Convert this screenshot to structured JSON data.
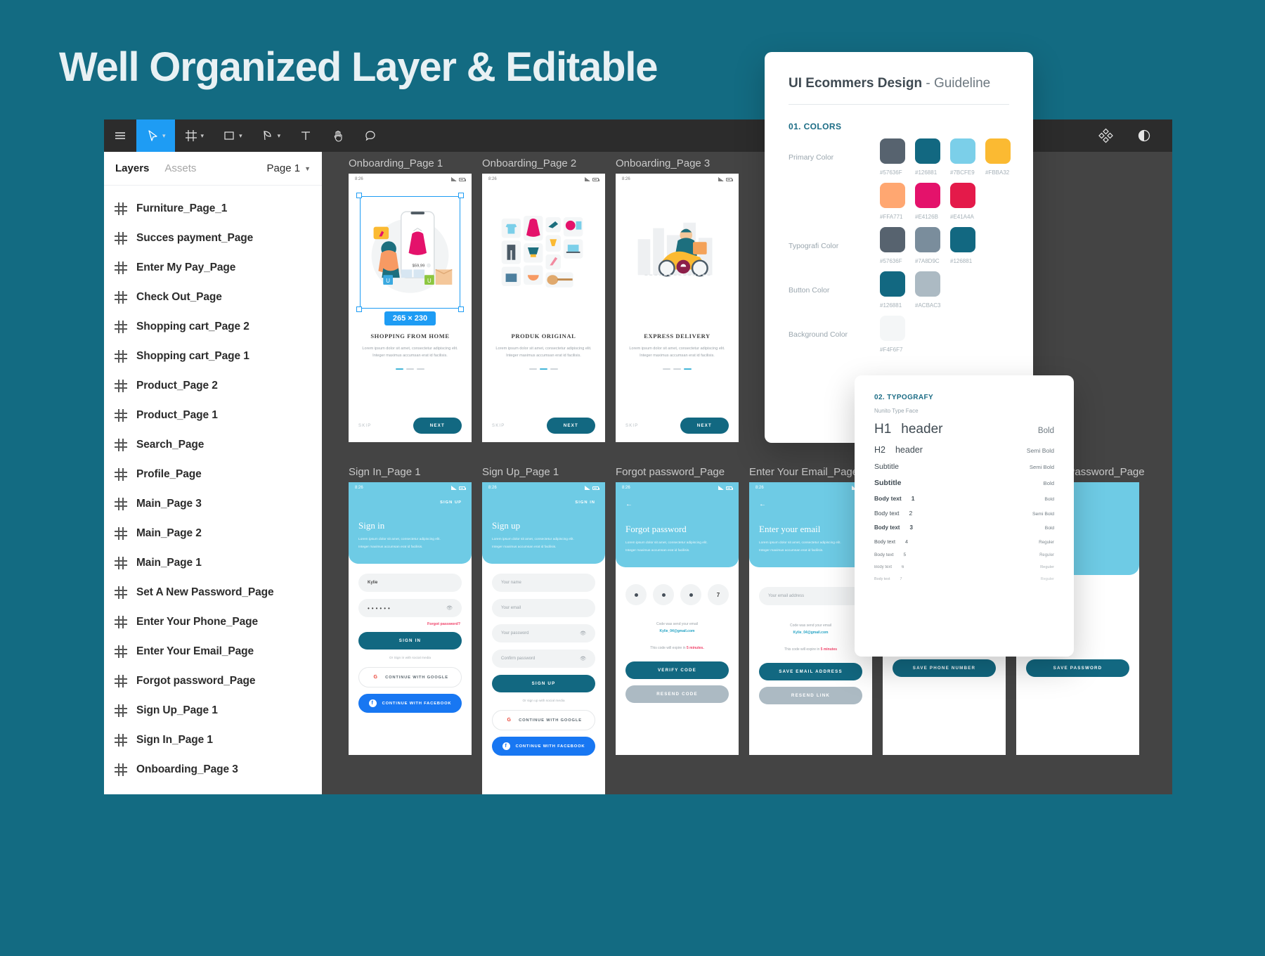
{
  "hero": {
    "title": "Well Organized Layer & Editable"
  },
  "toolbar": {
    "items": [
      {
        "name": "menu-icon",
        "label": "Menu",
        "caret": false
      },
      {
        "name": "move-tool-icon",
        "label": "Move",
        "caret": true
      },
      {
        "name": "frame-tool-icon",
        "label": "Frame",
        "caret": true
      },
      {
        "name": "shape-tool-icon",
        "label": "Shape",
        "caret": true
      },
      {
        "name": "pen-tool-icon",
        "label": "Pen",
        "caret": true
      },
      {
        "name": "text-tool-icon",
        "label": "Text",
        "caret": false
      },
      {
        "name": "hand-tool-icon",
        "label": "Hand",
        "caret": false
      },
      {
        "name": "comment-tool-icon",
        "label": "Comment",
        "caret": false
      }
    ],
    "right": [
      {
        "name": "components-icon",
        "label": "Components"
      },
      {
        "name": "contrast-icon",
        "label": "Contrast"
      }
    ]
  },
  "layers_panel": {
    "tab_layers": "Layers",
    "tab_assets": "Assets",
    "page_selector": "Page 1",
    "items": [
      {
        "label": "Furniture_Page_1"
      },
      {
        "label": "Succes payment_Page"
      },
      {
        "label": "Enter My Pay_Page"
      },
      {
        "label": "Check Out_Page"
      },
      {
        "label": "Shopping cart_Page 2"
      },
      {
        "label": "Shopping cart_Page 1"
      },
      {
        "label": "Product_Page 2"
      },
      {
        "label": "Product_Page 1"
      },
      {
        "label": "Search_Page"
      },
      {
        "label": "Profile_Page"
      },
      {
        "label": "Main_Page 3"
      },
      {
        "label": "Main_Page 2"
      },
      {
        "label": "Main_Page 1"
      },
      {
        "label": "Set A New Password_Page"
      },
      {
        "label": "Enter Your Phone_Page"
      },
      {
        "label": "Enter Your Email_Page"
      },
      {
        "label": "Forgot password_Page"
      },
      {
        "label": "Sign Up_Page 1"
      },
      {
        "label": "Sign In_Page 1"
      },
      {
        "label": "Onboarding_Page 3"
      }
    ]
  },
  "canvas": {
    "selection_size_badge": "265 × 230",
    "status_time": "8:26",
    "onboarding": [
      {
        "frame_title": "Onboarding_Page 1",
        "heading": "SHOPPING FROM HOME",
        "desc": "Lorem ipsum dolor sit amet, consectetur adipiscing elit. Integer maximus accumsan erat id facilisis.",
        "skip": "SKIP",
        "next": "NEXT",
        "price_tag": "$59,99",
        "active_dot": 0
      },
      {
        "frame_title": "Onboarding_Page 2",
        "heading": "PRODUK ORIGINAL",
        "desc": "Lorem ipsum dolor sit amet, consectetur adipiscing elit. Integer maximus accumsan erat id facilisis.",
        "skip": "SKIP",
        "next": "NEXT",
        "active_dot": 1
      },
      {
        "frame_title": "Onboarding_Page 3",
        "heading": "EXPRESS DELIVERY",
        "desc": "Lorem ipsum dolor sit amet, consectetur adipiscing elit. Integer maximus accumsan erat id facilisis.",
        "skip": "SKIP",
        "next": "NEXT",
        "active_dot": 2
      }
    ],
    "signin": {
      "frame_title": "Sign In_Page 1",
      "top_link": "SIGN UP",
      "title": "Sign in",
      "sub_line1": "Lorem ipsum dolor sit amet, consectetur adipiscing elit.",
      "sub_line2": "Integer maximus accumsan erat id facilisis.",
      "username_value": "Kylie",
      "password_value": "••••••",
      "forgot": "Forgot password?",
      "submit": "SIGN IN",
      "or": "Or Sign in with social media",
      "google": "CONTINUE WITH GOOGLE",
      "facebook": "CONTINUE WITH FACEBOOK"
    },
    "signup": {
      "frame_title": "Sign Up_Page 1",
      "top_link": "SIGN IN",
      "title": "Sign up",
      "sub_line1": "Lorem ipsum dolor sit amet, consectetur adipiscing elit.",
      "sub_line2": "Integer maximus accumsan erat id facilisis.",
      "name_placeholder": "Your name",
      "email_placeholder": "Your email",
      "password_placeholder": "Your password",
      "confirm_placeholder": "Confirm password",
      "submit": "SIGN UP",
      "or": "Or sign up with social media",
      "google": "CONTINUE WITH GOOGLE",
      "facebook": "CONTINUE WITH FACEBOOK"
    },
    "forgot": {
      "frame_title": "Forgot password_Page",
      "title": "Forgot password",
      "sub_line1": "Lorem ipsum dolor sit amet, consectetur adipiscing elit.",
      "sub_line2": "Integer maximus accumsan erat id facilisis.",
      "otp_last": "7",
      "code_sent": "Code was send your email",
      "code_email": "Kylie_04@gmail.com",
      "expire_pre": "This code will expire in",
      "expire_time": "5 minutes.",
      "verify": "VERIFY CODE",
      "resend": "RESEND CODE"
    },
    "enter_email": {
      "frame_title": "Enter Your Email_Page",
      "title": "Enter your email",
      "sub_line1": "Lorem ipsum dolor sit amet, consectetur adipiscing elit.",
      "sub_line2": "Integer maximus accumsan erat id facilisis.",
      "email_placeholder": "Your email address",
      "code_sent": "Code was send your email",
      "code_email": "Kylie_04@gmail.com",
      "expire_pre": "This code will expire in",
      "expire_time": "5 minutes",
      "save": "SAVE EMAIL ADDRESS",
      "resend": "RESEND LINK"
    },
    "enter_phone": {
      "save": "SAVE PHONE NUMBER"
    },
    "set_password": {
      "frame_title": "Set A New Password_Page",
      "save": "SAVE PASSWORD"
    }
  },
  "guideline": {
    "title_bold": "UI Ecommers Design",
    "title_light": " - Guideline",
    "colors_section": "01. COLORS",
    "rows": [
      {
        "label": "Primary Color",
        "swatches": [
          {
            "hex": "#57636F"
          },
          {
            "hex": "#126881"
          },
          {
            "hex": "#7BCFE9"
          },
          {
            "hex": "#FBBA32"
          }
        ]
      },
      {
        "label": "",
        "swatches": [
          {
            "hex": "#FFA771"
          },
          {
            "hex": "#E4126B"
          },
          {
            "hex": "#E41A4A"
          }
        ]
      },
      {
        "label": "Typografi Color",
        "swatches": [
          {
            "hex": "#57636F"
          },
          {
            "hex": "#7A8D9C"
          },
          {
            "hex": "#126881"
          }
        ]
      },
      {
        "label": "Button Color",
        "swatches": [
          {
            "hex": "#126881"
          },
          {
            "hex": "#ACBAC3"
          }
        ]
      },
      {
        "label": "Background Color",
        "swatches": [
          {
            "hex": "#F4F6F7"
          }
        ]
      }
    ]
  },
  "typography": {
    "section": "02. TYPOGRAFY",
    "face": "Nunito Type Face",
    "rows": [
      {
        "name": "H1",
        "sample": "header",
        "weight": "Bold"
      },
      {
        "name": "H2",
        "sample": "header",
        "weight": "Semi Bold"
      },
      {
        "name": "Subtitle",
        "sample": "",
        "weight": "Semi Bold"
      },
      {
        "name": "Subtitle",
        "sample": "",
        "weight": "Bold"
      },
      {
        "name": "Body text",
        "sample": "1",
        "weight": "Bold"
      },
      {
        "name": "Body text",
        "sample": "2",
        "weight": "Semi Bold"
      },
      {
        "name": "Body text",
        "sample": "3",
        "weight": "Bold"
      },
      {
        "name": "Body text",
        "sample": "4",
        "weight": "Reguler"
      },
      {
        "name": "Body text",
        "sample": "5",
        "weight": "Reguler"
      },
      {
        "name": "Body text",
        "sample": "6",
        "weight": "Reguler"
      },
      {
        "name": "Body text",
        "sample": "7",
        "weight": "Reguler"
      }
    ]
  }
}
